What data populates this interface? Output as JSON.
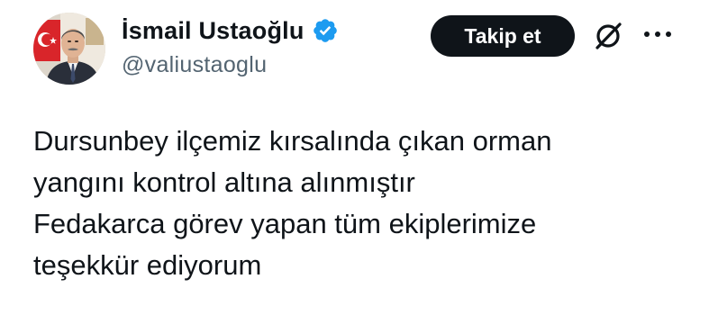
{
  "user": {
    "display_name": "İsmail Ustaoğlu",
    "handle": "@valiustaoglu",
    "verified": true,
    "avatar_icon": "profile-photo"
  },
  "actions": {
    "follow_label": "Takip et",
    "grok_icon": "grok-icon",
    "more_icon": "more-icon"
  },
  "tweet": {
    "lines": [
      "Dursunbey ilçemiz kırsalında çıkan orman",
      "yangını kontrol altına alınmıştır",
      "Fedakarca görev yapan tüm ekiplerimize",
      "teşekkür ediyorum"
    ]
  },
  "colors": {
    "verified_blue": "#1d9bf0",
    "text": "#0f1419",
    "secondary_text": "#536471",
    "button_bg": "#0f1419"
  }
}
